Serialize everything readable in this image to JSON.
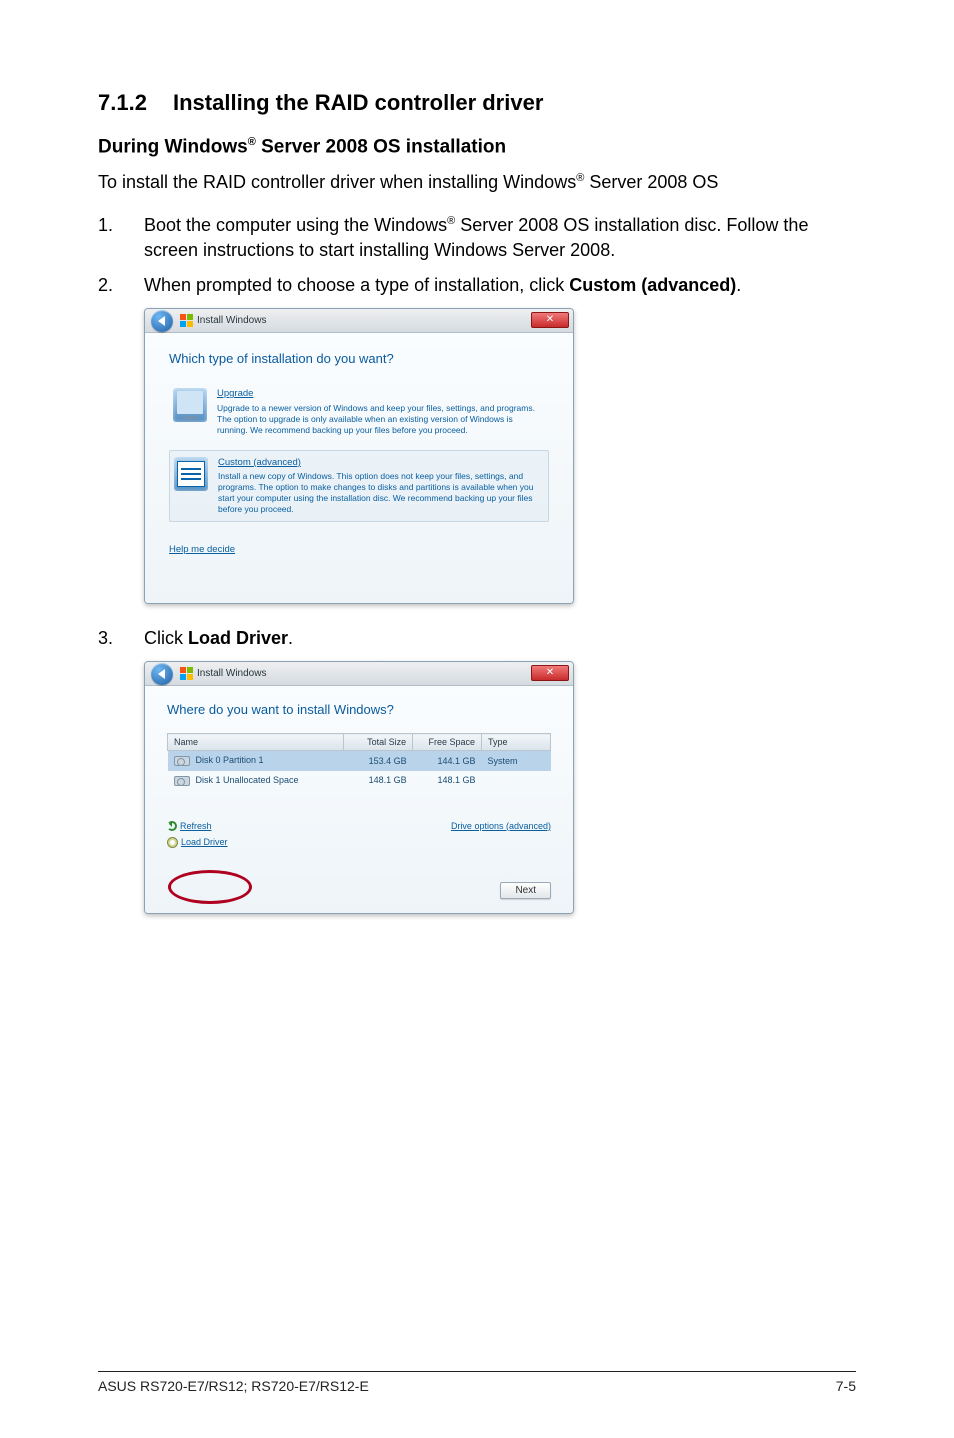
{
  "section": {
    "number": "7.1.2",
    "title": "Installing the RAID controller driver"
  },
  "subheading": {
    "prefix": "During Windows",
    "reg": "®",
    "suffix": " Server 2008 OS installation"
  },
  "intro": {
    "prefix": "To install the RAID controller driver when installing Windows",
    "reg": "®",
    "suffix": " Server 2008 OS"
  },
  "steps": {
    "s1": {
      "num": "1.",
      "line1_a": "Boot the computer using the Windows",
      "line1_reg": "®",
      "line1_b": " Server 2008 OS installation disc. Follow the screen instructions to start installing Windows Server 2008."
    },
    "s2": {
      "num": "2.",
      "text_a": "When prompted to choose a type of installation, click ",
      "bold": "Custom (advanced)",
      "text_b": "."
    },
    "s3": {
      "num": "3.",
      "text_a": "Click ",
      "bold": "Load Driver",
      "text_b": "."
    }
  },
  "dialog1": {
    "title": "Install Windows",
    "heading": "Which type of installation do you want?",
    "upgrade": {
      "title": "Upgrade",
      "desc": "Upgrade to a newer version of Windows and keep your files, settings, and programs. The option to upgrade is only available when an existing version of Windows is running. We recommend backing up your files before you proceed."
    },
    "custom": {
      "title": "Custom (advanced)",
      "desc": "Install a new copy of Windows. This option does not keep your files, settings, and programs. The option to make changes to disks and partitions is available when you start your computer using the installation disc. We recommend backing up your files before you proceed."
    },
    "help": "Help me decide"
  },
  "dialog2": {
    "title": "Install Windows",
    "heading": "Where do you want to install Windows?",
    "cols": {
      "name": "Name",
      "total": "Total Size",
      "free": "Free Space",
      "type": "Type"
    },
    "rows": [
      {
        "name": "Disk 0 Partition 1",
        "total": "153.4 GB",
        "free": "144.1 GB",
        "type": "System"
      },
      {
        "name": "Disk 1 Unallocated Space",
        "total": "148.1 GB",
        "free": "148.1 GB",
        "type": ""
      }
    ],
    "refresh": "Refresh",
    "load_driver": "Load Driver",
    "drive_opts": "Drive options (advanced)",
    "next": "Next"
  },
  "footer": {
    "left": "ASUS RS720-E7/RS12; RS720-E7/RS12-E",
    "right": "7-5"
  }
}
